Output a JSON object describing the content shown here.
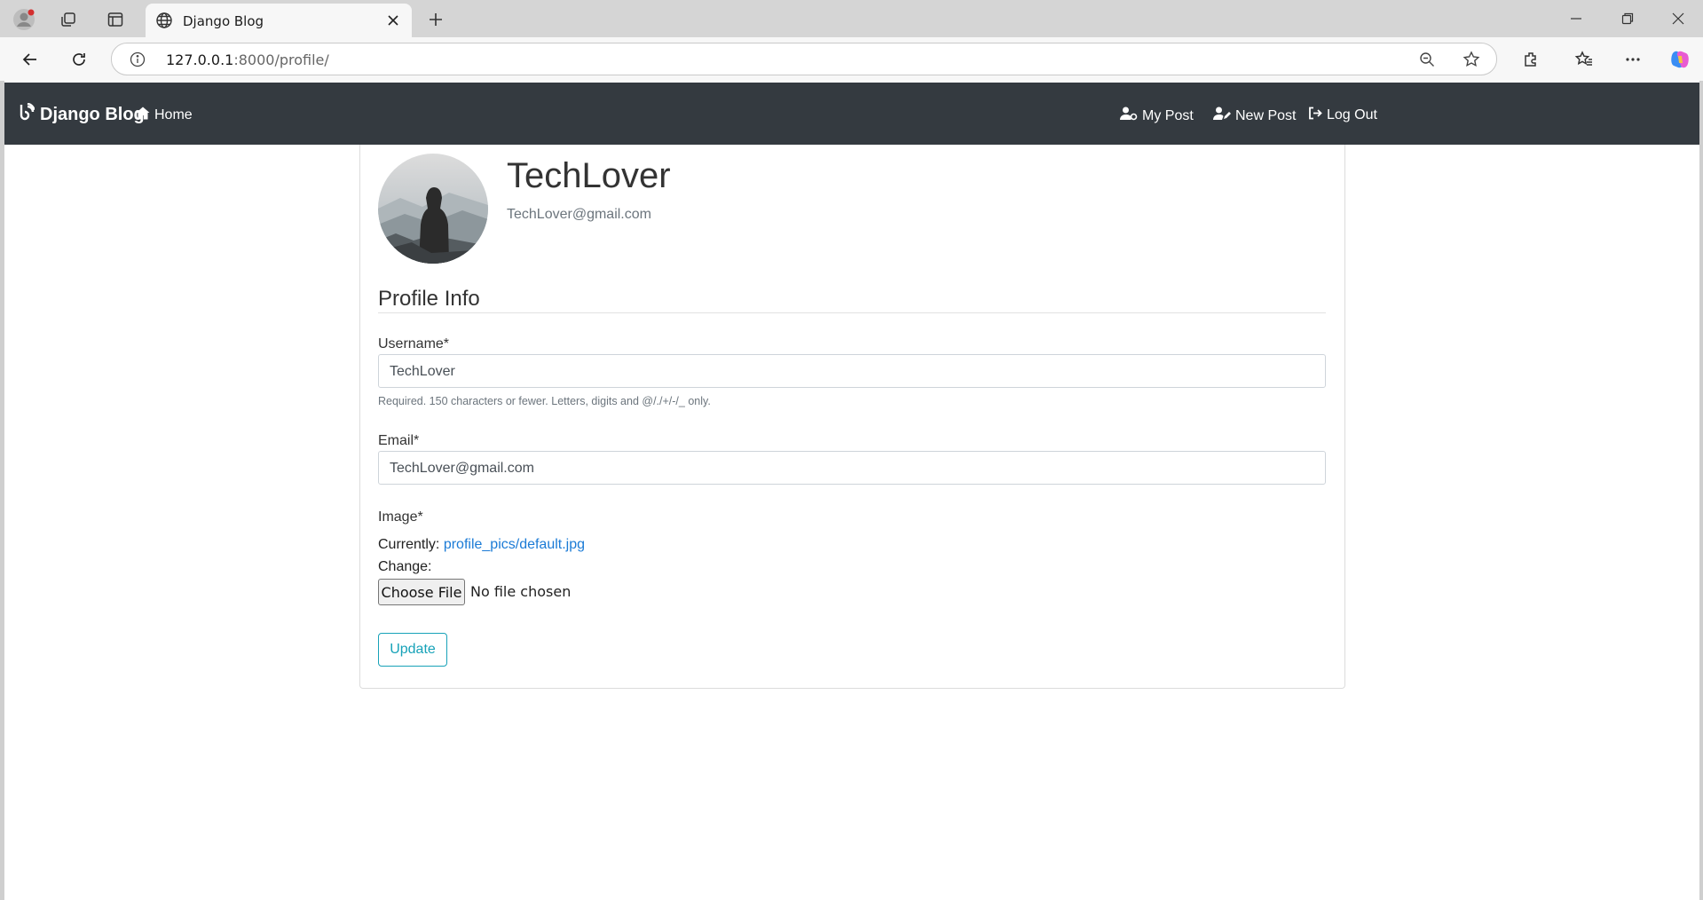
{
  "browser": {
    "tab_title": "Django Blog",
    "url_host": "127.0.0.1",
    "url_rest": ":8000/profile/"
  },
  "navbar": {
    "brand": "Django Blog",
    "home": "Home",
    "my_post": "My Post",
    "new_post": "New Post",
    "log_out": "Log Out",
    "background": "#343a40"
  },
  "profile": {
    "username": "TechLover",
    "email": "TechLover@gmail.com"
  },
  "form": {
    "legend": "Profile Info",
    "username_label": "Username*",
    "username_value": "TechLover",
    "username_help": "Required. 150 characters or fewer. Letters, digits and @/./+/-/_ only.",
    "email_label": "Email*",
    "email_value": "TechLover@gmail.com",
    "image_label": "Image*",
    "currently_label": "Currently:",
    "current_image": "profile_pics/default.jpg",
    "change_label": "Change:",
    "choose_file": "Choose File",
    "file_status": "No file chosen",
    "submit": "Update",
    "accent": "#17a2b8"
  }
}
